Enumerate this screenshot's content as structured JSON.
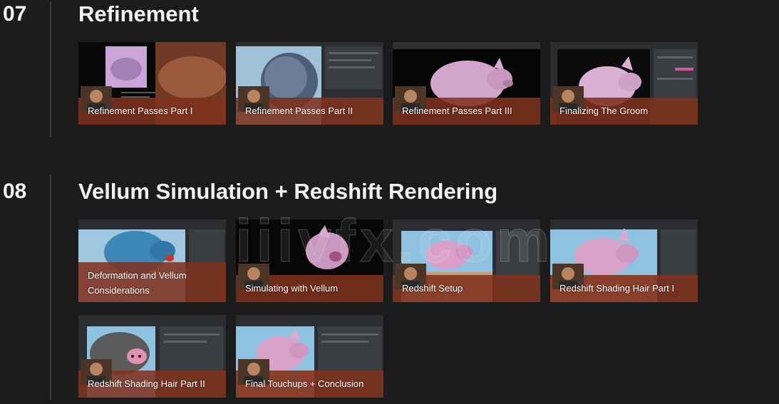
{
  "sections": [
    {
      "number": "07",
      "title": "Refinement",
      "lessons": [
        {
          "title": "Refinement Passes Part I",
          "thumb": "pig-photo"
        },
        {
          "title": "Refinement Passes Part II",
          "thumb": "fur-closeup"
        },
        {
          "title": "Refinement Passes Part III",
          "thumb": "pig-dark"
        },
        {
          "title": "Finalizing The Groom",
          "thumb": "pig-ui"
        }
      ]
    },
    {
      "number": "08",
      "title": "Vellum Simulation + Redshift Rendering",
      "lessons": [
        {
          "title": "Deformation and Vellum Considerations",
          "thumb": "pig-blue"
        },
        {
          "title": "Simulating with Vellum",
          "thumb": "pig-dark"
        },
        {
          "title": "Redshift Setup",
          "thumb": "pig-sky"
        },
        {
          "title": "Redshift Shading Hair Part I",
          "thumb": "pig-sky-large"
        },
        {
          "title": "Redshift Shading Hair Part II",
          "thumb": "pig-gray"
        },
        {
          "title": "Final Touchups + Conclusion",
          "thumb": "pig-sky"
        }
      ]
    }
  ],
  "watermark": "iiivfx.com",
  "colors": {
    "background": "#1b1b1b",
    "caption_band": "#80321e",
    "pig_pink": "#d9a3c9",
    "sky_blue": "#8fc1e0"
  }
}
